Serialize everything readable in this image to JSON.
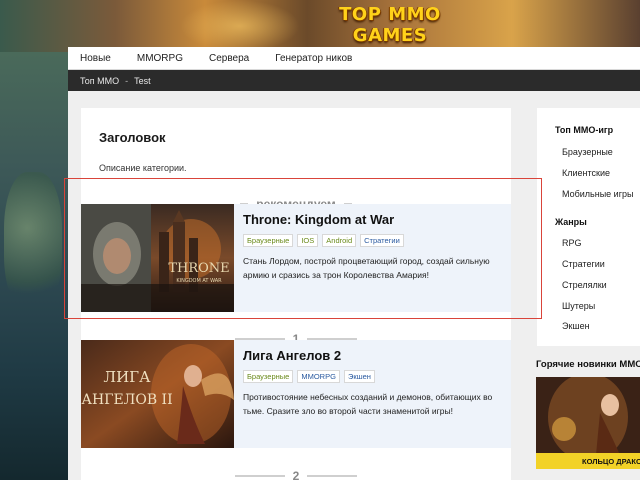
{
  "site": {
    "title": "TOP MMO GAMES"
  },
  "nav": {
    "items": [
      "Новые",
      "MMORPG",
      "Сервера",
      "Генератор ников"
    ]
  },
  "breadcrumb": {
    "home": "Топ ММО",
    "separator": "-",
    "current": "Test"
  },
  "category": {
    "title": "Заголовок",
    "description": "Описание категории."
  },
  "recommend_label": "рекомендуем",
  "games": [
    {
      "title": "Throne: Kingdom at War",
      "thumb_text": "THRONE",
      "thumb_sub": "KINGDOM AT WAR",
      "tags": [
        "Браузерные",
        "IOS",
        "Android",
        "Стратегии"
      ],
      "description": "Стань Лордом, построй процветающий город, создай сильную армию и сразись за трон Королевства Амария!"
    },
    {
      "rank": "1",
      "title": "Лига Ангелов 2",
      "thumb_text": "ЛИГА АНГЕЛОВ II",
      "tags": [
        "Браузерные",
        "MMORPG",
        "Экшен"
      ],
      "description": "Противостояние небесных созданий и демонов, обитающих во тьме. Сразите зло во второй части знаменитой игры!"
    }
  ],
  "next_rank": "2",
  "sidebar": {
    "groups": [
      {
        "title": "Топ ММО-игр",
        "items": [
          "Браузерные",
          "Клиентские",
          "Мобильные игры"
        ]
      },
      {
        "title": "Жанры",
        "items": [
          "RPG",
          "Стратегии",
          "Стрелялки",
          "Шутеры",
          "Экшен"
        ]
      }
    ]
  },
  "hot": {
    "title": "Горячие новинки ММО",
    "card_caption": "КОЛЬЦО ДРАКОНА"
  },
  "colors": {
    "accent": "#ffd21a",
    "highlight_border": "#d9443a",
    "nav_dark": "#2b2b2b"
  }
}
